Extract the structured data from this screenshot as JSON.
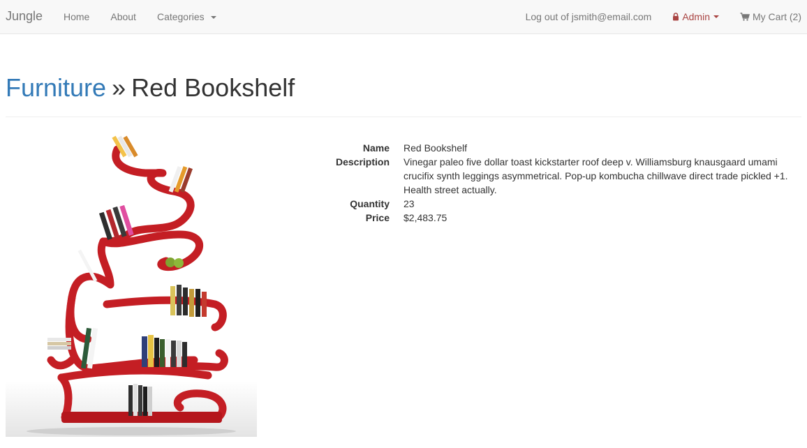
{
  "navbar": {
    "brand": "Jungle",
    "left_items": [
      {
        "label": "Home"
      },
      {
        "label": "About"
      },
      {
        "label": "Categories"
      }
    ],
    "logout_label": "Log out of jsmith@email.com",
    "admin_label": "Admin",
    "cart_label": "My Cart (2)"
  },
  "page": {
    "category": "Furniture",
    "separator": "»",
    "product_name": "Red Bookshelf"
  },
  "details": {
    "name_label": "Name",
    "name_value": "Red Bookshelf",
    "description_label": "Description",
    "description_value": "Vinegar paleo five dollar toast kickstarter roof deep v. Williamsburg knausgaard umami crucifix synth leggings asymmetrical. Pop-up kombucha chillwave direct trade pickled +1. Health street actually.",
    "quantity_label": "Quantity",
    "quantity_value": "23",
    "price_label": "Price",
    "price_value": "$2,483.75"
  },
  "colors": {
    "link": "#337ab7",
    "admin": "#a94442",
    "shelf_red": "#c41e24"
  },
  "icons": {
    "admin": "lock-icon",
    "cart": "shopping-cart-icon",
    "dropdown": "caret-down-icon"
  }
}
